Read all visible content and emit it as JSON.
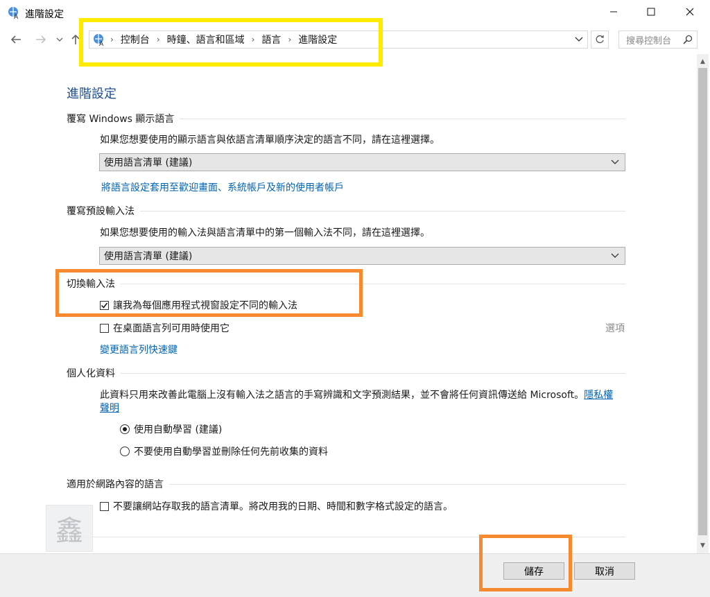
{
  "window": {
    "title": "進階設定"
  },
  "address": {
    "crumbs": [
      "控制台",
      "時鐘、語言和區域",
      "語言",
      "進階設定"
    ],
    "search_placeholder": "搜尋控制台"
  },
  "page": {
    "title": "進階設定"
  },
  "display_lang": {
    "heading": "覆寫 Windows 顯示語言",
    "desc": "如果您想要使用的顯示語言與依語言清單順序決定的語言不同，請在這裡選擇。",
    "dropdown_value": "使用語言清單 (建議)",
    "link": "將語言設定套用至歡迎畫面、系統帳戶及新的使用者帳戶"
  },
  "default_ime": {
    "heading": "覆寫預設輸入法",
    "desc": "如果您想要使用的輸入法與語言清單中的第一個輸入法不同，請在這裡選擇。",
    "dropdown_value": "使用語言清單 (建議)"
  },
  "switch_ime": {
    "heading": "切換輸入法",
    "checkbox1_label": "讓我為每個應用程式視窗設定不同的輸入法",
    "checkbox1_checked": true,
    "checkbox2_label": "在桌面語言列可用時使用它",
    "checkbox2_checked": false,
    "options_link": "選項",
    "hotkey_link": "變更語言列快速鍵"
  },
  "personalization": {
    "heading": "個人化資料",
    "desc": "此資料只用來改善此電腦上沒有輸入法之語言的手寫辨識和文字預測結果，並不會將任何資訊傳送給 Microsoft。",
    "privacy_link_a": "隱私權",
    "privacy_link_b": "聲明",
    "radio1_label": "使用自動學習 (建議)",
    "radio1_selected": true,
    "radio2_label": "不要使用自動學習並刪除任何先前收集的資料",
    "radio2_selected": false
  },
  "web_lang": {
    "heading": "適用於網路內容的語言",
    "checkbox_label": "不要讓網站存取我的語言清單。將改用我的日期、時間和數字格式設定的語言。",
    "checkbox_checked": false
  },
  "footer": {
    "save_label": "儲存",
    "cancel_label": "取消"
  },
  "watermark": {
    "glyph": "鑫"
  },
  "colors": {
    "link": "#0063b1",
    "title": "#1e4e8c",
    "yellow_highlight": "#ffeb00",
    "orange_highlight": "#f7892f"
  }
}
